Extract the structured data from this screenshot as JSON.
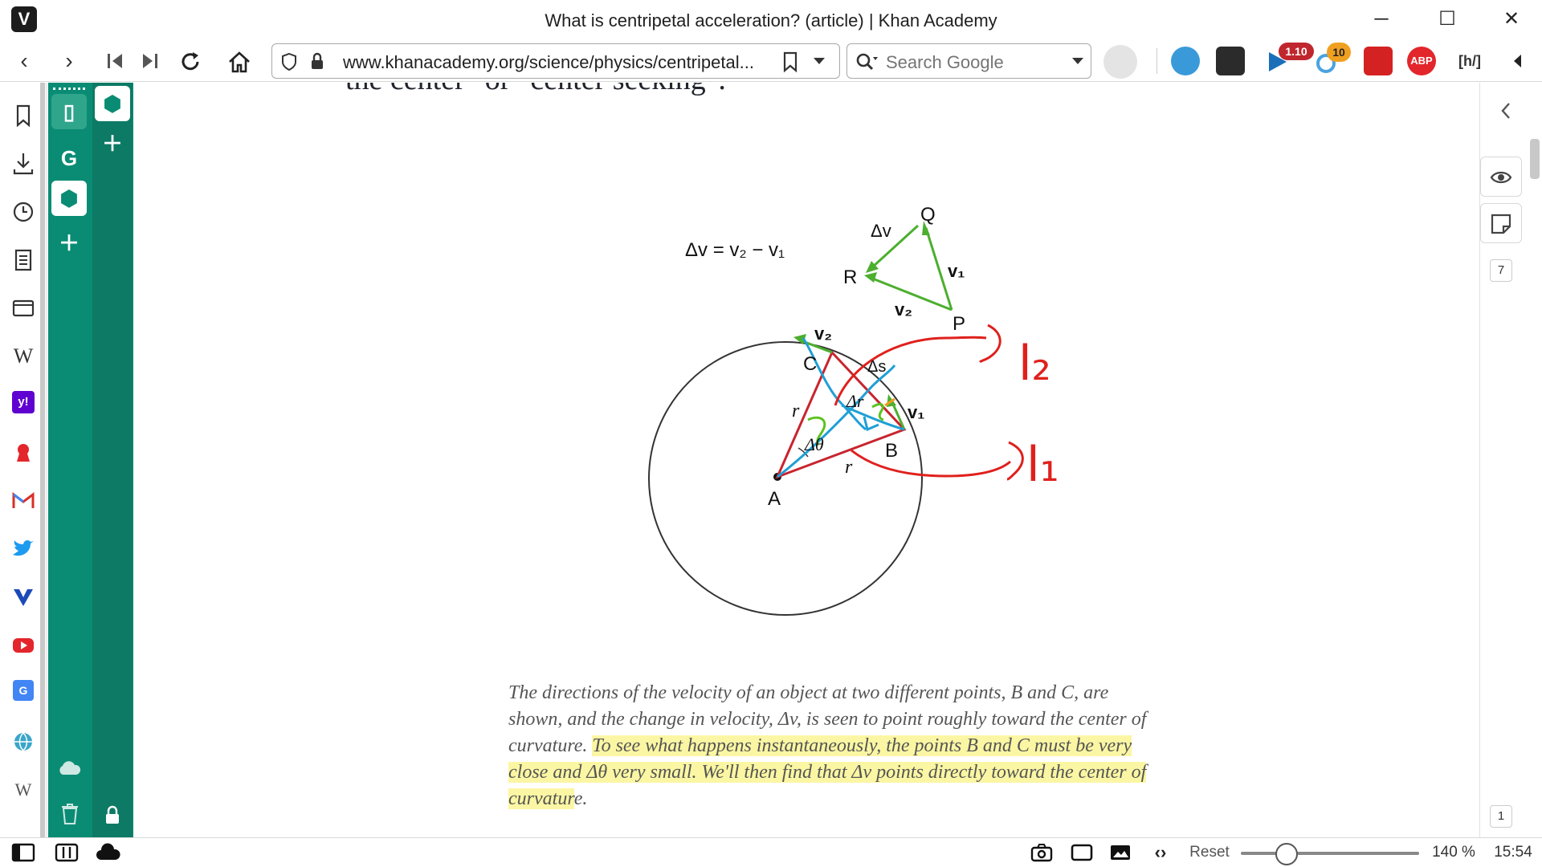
{
  "window": {
    "title": "What is centripetal acceleration? (article) | Khan Academy",
    "logo": "V",
    "minimize": "─",
    "maximize": "☐",
    "close": "✕"
  },
  "toolbar": {
    "back": "‹",
    "forward": "›",
    "url": "www.khanacademy.org/science/physics/centripetal...",
    "search_placeholder": "Search Google",
    "badge_a": "1.10",
    "badge_b": "10",
    "abp": "ABP",
    "hint": "[h/]"
  },
  "content": {
    "heading_fragment": "the center\" or \"center seeking\".",
    "caption_plain": "The directions of the velocity of an object at two different points, B and C, are shown, and the change in velocity, Δv, is seen to point roughly toward the center of curvature. ",
    "caption_highlight": "To see what happens instantaneously, the points B and C must be very close and Δθ very small. We'll then find that Δv points directly toward the center of curvatur",
    "caption_tail": "e."
  },
  "diagram": {
    "equation": "Δv = v₂ − v₁",
    "label_dv": "Δv",
    "label_Q": "Q",
    "label_R": "R",
    "label_P": "P",
    "label_v1_tri": "v₁",
    "label_v2_tri": "v₂",
    "label_v2": "v₂",
    "label_v1": "v₁",
    "label_C": "C",
    "label_ds": "Δs",
    "label_dr": "Δr",
    "label_r1": "r",
    "label_r2": "r",
    "label_dtheta": "Δθ",
    "label_B": "B",
    "label_A": "A",
    "annot_l2": "l₂",
    "annot_l1": "l₁"
  },
  "right_panel": {
    "badge_top": "7",
    "badge_bottom": "1"
  },
  "statusbar": {
    "reset": "Reset",
    "zoom": "140 %",
    "time": "15:54"
  },
  "colors": {
    "accent_teal": "#0a8c74",
    "diagram_red": "#c8242e",
    "diagram_green": "#4caf2e",
    "annot_blue": "#1f9fd6",
    "annot_red": "#e0201c",
    "highlight": "#fbf6a3"
  }
}
